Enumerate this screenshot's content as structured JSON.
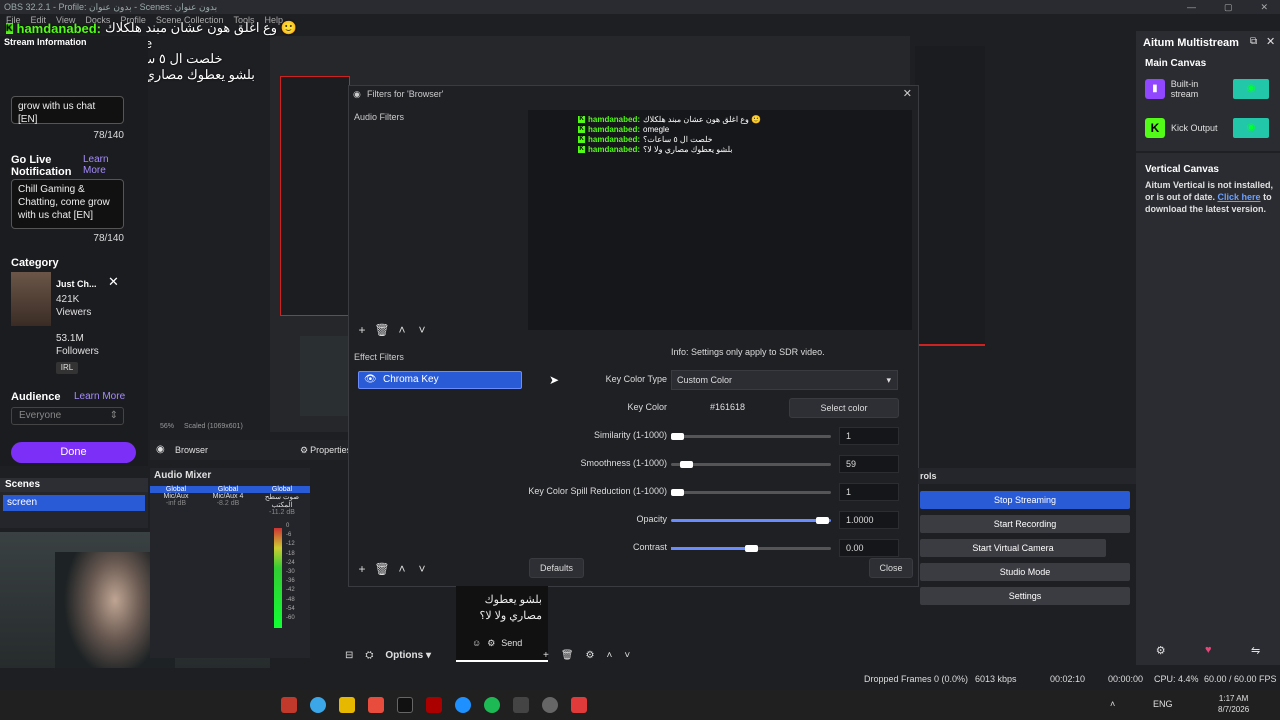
{
  "window": {
    "title": "OBS 32.2.1 - Profile: بدون عنوان - Scenes: بدون عنوان"
  },
  "menu": [
    "File",
    "Edit",
    "View",
    "Docks",
    "Profile",
    "Scene Collection",
    "Tools",
    "Help"
  ],
  "chat": [
    {
      "user": "hamdanabed:",
      "msg": "وع اغلق هون عشان مبند هلكلاك 🙂"
    },
    {
      "user": "hamdanabed:",
      "msg": "omegle"
    },
    {
      "user": "hamdanabed:",
      "msg": "خلصت ال ٥ ساعات؟"
    },
    {
      "user": "hamdanabed:",
      "msg": "بلشو يعطوك مصاري ولا لا؟"
    }
  ],
  "left_panel": {
    "stream_info": "Stream Information",
    "title_text": "grow with us chat [EN]",
    "title_count": "78/140",
    "go_live": "Go Live Notification",
    "learn_more": "Learn More",
    "notif_text": "Chill Gaming & Chatting, come grow with us chat [EN]",
    "notif_count": "78/140",
    "category_label": "Category",
    "cat_name": "Just Ch...",
    "cat_viewers": "421K",
    "viewers_label": "Viewers",
    "cat_followers": "53.1M",
    "followers_label": "Followers",
    "tag": "IRL",
    "audience_label": "Audience",
    "audience_learn": "Learn More",
    "audience_value": "Everyone",
    "done": "Done"
  },
  "scenes": {
    "header": "Scenes",
    "items": [
      "screen"
    ]
  },
  "source_bar": {
    "source": "Browser",
    "properties": "Properties"
  },
  "mixer": {
    "header": "Audio Mixer",
    "channels": [
      {
        "scope": "Global",
        "name": "Mic/Aux",
        "db": "-inf dB"
      },
      {
        "scope": "Global",
        "name": "Mic/Aux 4",
        "db": "-8.2 dB"
      },
      {
        "scope": "Global",
        "name": "صوت سطح المكتب",
        "db": "-11.2 dB"
      }
    ],
    "scale": [
      "0",
      "-6",
      "-12",
      "-18",
      "-24",
      "-30",
      "-36",
      "-42",
      "-48",
      "-54",
      "-60"
    ]
  },
  "dialog": {
    "title": "Filters for 'Browser'",
    "audio_filters": "Audio Filters",
    "effect_filters": "Effect Filters",
    "filter_item": "Chroma Key",
    "info": "Info: Settings only apply to SDR video.",
    "key_color_type_label": "Key Color Type",
    "key_color_type": "Custom Color",
    "key_color_label": "Key Color",
    "key_color_value": "#161618",
    "select_color": "Select color",
    "similarity_label": "Similarity (1-1000)",
    "similarity": "1",
    "smoothness_label": "Smoothness (1-1000)",
    "smoothness": "59",
    "spill_label": "Key Color Spill Reduction (1-1000)",
    "spill": "1",
    "opacity_label": "Opacity",
    "opacity": "1.0000",
    "contrast_label": "Contrast",
    "contrast": "0.00",
    "defaults": "Defaults",
    "close": "Close"
  },
  "multistream": {
    "title": "Aitum Multistream",
    "main_canvas": "Main Canvas",
    "outputs": [
      {
        "name": "Built-in stream",
        "icon": "twitch-icon",
        "color": "#9146ff"
      },
      {
        "name": "Kick Output",
        "icon": "kick-icon",
        "color": "#53fc18"
      }
    ],
    "vertical": "Vertical Canvas",
    "vertical_msg": "Aitum Vertical is not installed, or is out of date.",
    "click_here": "Click here",
    "download_msg": "to download the latest version."
  },
  "controls": {
    "header": "rols",
    "stop_streaming": "Stop Streaming",
    "start_recording": "Start Recording",
    "start_virtual": "Start Virtual Camera",
    "studio": "Studio Mode",
    "settings": "Settings"
  },
  "chat_popup": {
    "text": "بلشو يعطوك مصاري ولا لا؟",
    "send": "Send"
  },
  "options": "Options",
  "statusbar": {
    "dropped": "Dropped Frames 0 (0.0%)",
    "kbps": "6013 kbps",
    "stream_time": "00:02:10",
    "rec_time": "00:00:00",
    "cpu": "CPU: 4.4%",
    "fps": "60.00 / 60.00 FPS"
  },
  "tray": {
    "lang": "ENG",
    "time": "1:17 AM",
    "date": "8/7/2026"
  },
  "preview_info": {
    "zoom": "56%",
    "scaled": "Scaled (1069x601)"
  }
}
